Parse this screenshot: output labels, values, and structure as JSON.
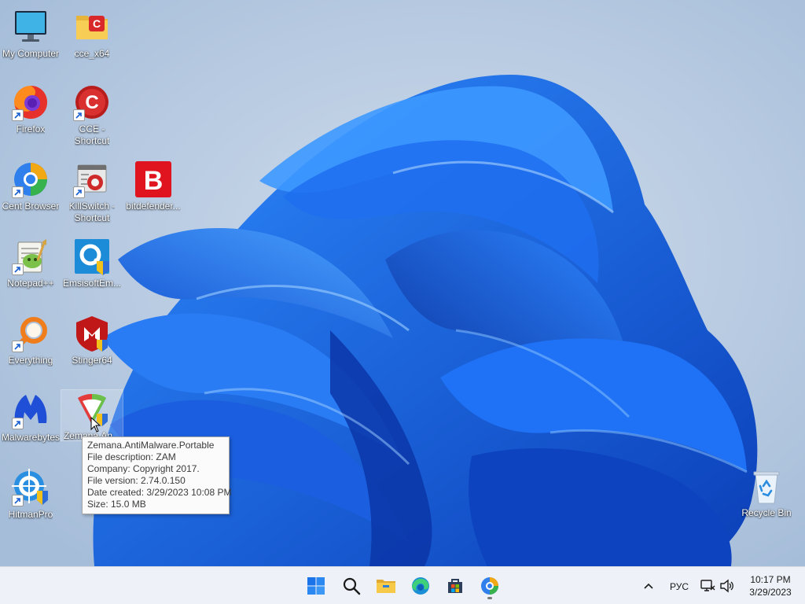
{
  "desktop": {
    "icons": [
      {
        "id": "my-computer",
        "label": "My Computer",
        "shortcut": false
      },
      {
        "id": "cce-x64",
        "label": "cce_x64",
        "shortcut": false
      },
      {
        "id": "firefox",
        "label": "Firefox",
        "shortcut": true
      },
      {
        "id": "cce-shortcut",
        "label": "CCE -\nShortcut",
        "shortcut": true
      },
      {
        "id": "cent-browser",
        "label": "Cent Browser",
        "shortcut": true
      },
      {
        "id": "killswitch",
        "label": "KillSwitch -\nShortcut",
        "shortcut": true
      },
      {
        "id": "bitdefender",
        "label": "bitdefender...",
        "shortcut": false
      },
      {
        "id": "notepadpp",
        "label": "Notepad++",
        "shortcut": true
      },
      {
        "id": "emsisoft",
        "label": "EmsisoftEm...",
        "shortcut": false
      },
      {
        "id": "everything",
        "label": "Everything",
        "shortcut": true
      },
      {
        "id": "stinger64",
        "label": "Stinger64",
        "shortcut": false
      },
      {
        "id": "malwarebytes",
        "label": "Malwarebytes",
        "shortcut": true
      },
      {
        "id": "zemana",
        "label": "Zemana.An...",
        "shortcut": false
      },
      {
        "id": "hitmanpro",
        "label": "HitmanPro",
        "shortcut": true
      },
      {
        "id": "recycle-bin",
        "label": "Recycle Bin",
        "shortcut": false
      }
    ]
  },
  "tooltip": {
    "lines": [
      "Zemana.AntiMalware.Portable",
      "File description: ZAM",
      "Company: Copyright 2017.",
      "File version: 2.74.0.150",
      "Date created: 3/29/2023 10:08 PM",
      "Size: 15.0 MB"
    ]
  },
  "taskbar": {
    "buttons": [
      "windows-start-icon",
      "search-icon",
      "file-explorer-icon",
      "edge-icon",
      "store-icon",
      "cent-browser-icon"
    ],
    "language": "РУС",
    "time": "10:17 PM",
    "date": "3/29/2023"
  },
  "colors": {
    "accent": "#1f6fe0",
    "taskbar": "#eef1f7"
  }
}
